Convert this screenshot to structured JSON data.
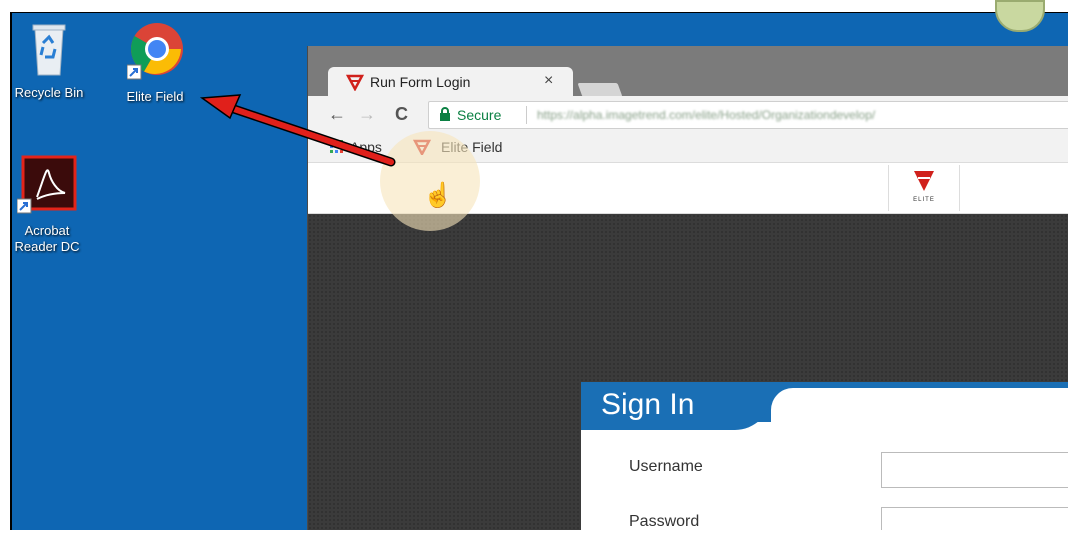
{
  "desktop": {
    "icons": [
      {
        "label": "Recycle Bin",
        "icon": "recycle-bin-icon"
      },
      {
        "label": "Elite Field",
        "icon": "chrome-icon"
      },
      {
        "label": "Acrobat Reader DC",
        "icon": "acrobat-icon"
      }
    ]
  },
  "browser": {
    "tab_title": "Run Form Login",
    "tab_close": "×",
    "back": "←",
    "forward": "→",
    "reload": "C",
    "secure_label": "Secure",
    "url": "https://alpha.imagetrend.com/elite/Hosted/Organizationdevelop/",
    "bookmarks": {
      "apps": "Apps",
      "elite_field": "Elite Field"
    },
    "site_logo_text": "ELITE"
  },
  "signin": {
    "title": "Sign In",
    "username_label": "Username",
    "password_label": "Password"
  },
  "colors": {
    "desktop_blue": "#0e66b3",
    "signin_blue": "#1a6fb5",
    "arrow_red": "#e0201b",
    "elite_red": "#d0211c"
  }
}
